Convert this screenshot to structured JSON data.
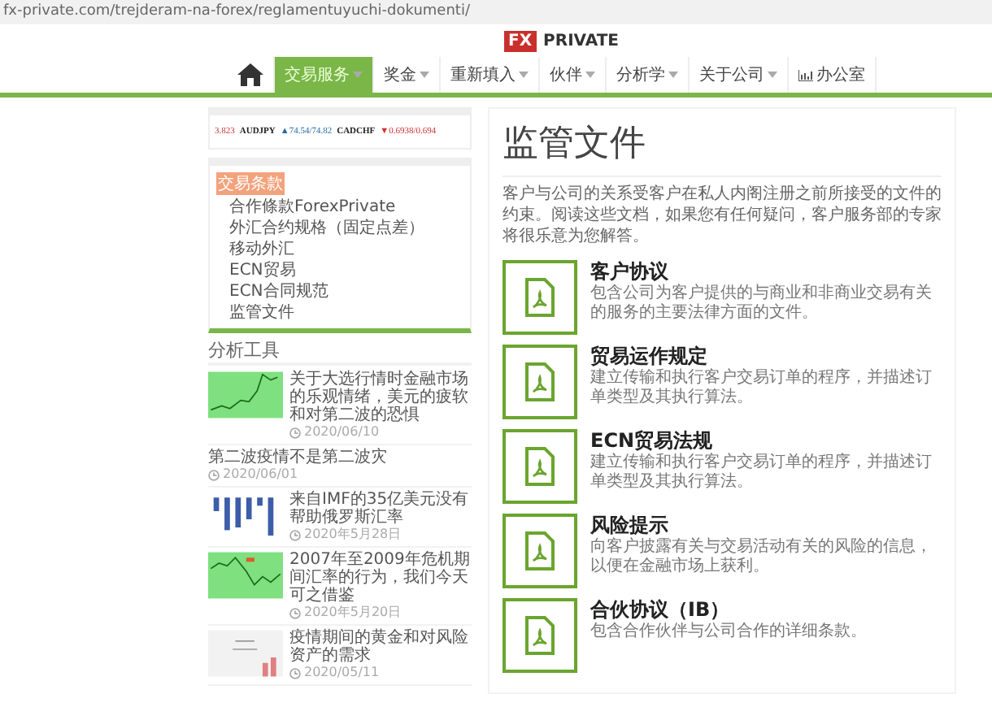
{
  "address_bar": {
    "url": "fx-private.com/trejderam-na-forex/reglamentuyuchi-dokumenti/"
  },
  "logo": {
    "mark": "FX",
    "name": "PRIVATE"
  },
  "nav": [
    {
      "kind": "home",
      "selected": false
    },
    {
      "kind": "menu",
      "label": "交易服务",
      "selected": true
    },
    {
      "kind": "menu",
      "label": "奖金",
      "selected": false
    },
    {
      "kind": "menu",
      "label": "重新填入",
      "selected": false
    },
    {
      "kind": "menu",
      "label": "伙伴",
      "selected": false
    },
    {
      "kind": "menu",
      "label": "分析学",
      "selected": false
    },
    {
      "kind": "menu",
      "label": "关于公司",
      "selected": false
    },
    {
      "kind": "office",
      "label": "办公室",
      "selected": false
    }
  ],
  "ticker": [
    {
      "kind": "plain",
      "text": "3.823"
    },
    {
      "kind": "pair",
      "text": "AUDJPY"
    },
    {
      "kind": "up",
      "text": "▲74.54/74.82"
    },
    {
      "kind": "pair",
      "text": "CADCHF"
    },
    {
      "kind": "down",
      "text": "▼0.6938/0.694"
    }
  ],
  "sidebar_menu": {
    "heading": "交易条款",
    "items": [
      {
        "label": "合作條款ForexPrivate"
      },
      {
        "label": "外汇合约规格（固定点差）"
      },
      {
        "label": "移动外汇"
      },
      {
        "label": "ECN贸易"
      },
      {
        "label": "ECN合同规范"
      },
      {
        "label": "监管文件"
      }
    ]
  },
  "analysis": {
    "heading": "分析工具",
    "articles": [
      {
        "kind": "rising",
        "title": "关于大选行情时金融市场的乐观情绪，美元的疲软和对第二波的恐惧",
        "date": "2020/06/10"
      },
      {
        "kind": "none",
        "title": "第二波疫情不是第二波灾",
        "date": "2020/06/01"
      },
      {
        "kind": "bars",
        "title": "来自IMF的35亿美元没有帮助俄罗斯汇率",
        "date": "2020年5月28日"
      },
      {
        "kind": "falling",
        "title": "2007年至2009年危机期间汇率的行为，我们今天可之借鉴",
        "date": "2020年5月20日"
      },
      {
        "kind": "table",
        "title": "疫情期间的黄金和对风险资产的需求",
        "date": "2020/05/11"
      }
    ]
  },
  "page": {
    "title": "监管文件",
    "intro": "客户与公司的关系受客户在私人内阁注册之前所接受的文件的约束。阅读这些文档，如果您有任何疑问，客户服务部的专家将很乐意为您解答。",
    "documents": [
      {
        "title": "客户协议",
        "description": "包含公司为客户提供的与商业和非商业交易有关的服务的主要法律方面的文件。"
      },
      {
        "title": "贸易运作规定",
        "description": "建立传输和执行客户交易订单的程序，并描述订单类型及其执行算法。"
      },
      {
        "title": "ECN贸易法规",
        "description": "建立传输和执行客户交易订单的程序，并描述订单类型及其执行算法。"
      },
      {
        "title": "风险提示",
        "description": "向客户披露有关与交易活动有关的风险的信息，以便在金融市场上获利。"
      },
      {
        "title": "合伙协议（IB）",
        "description": "包含合作伙伴与公司合作的详细条款。"
      }
    ]
  }
}
